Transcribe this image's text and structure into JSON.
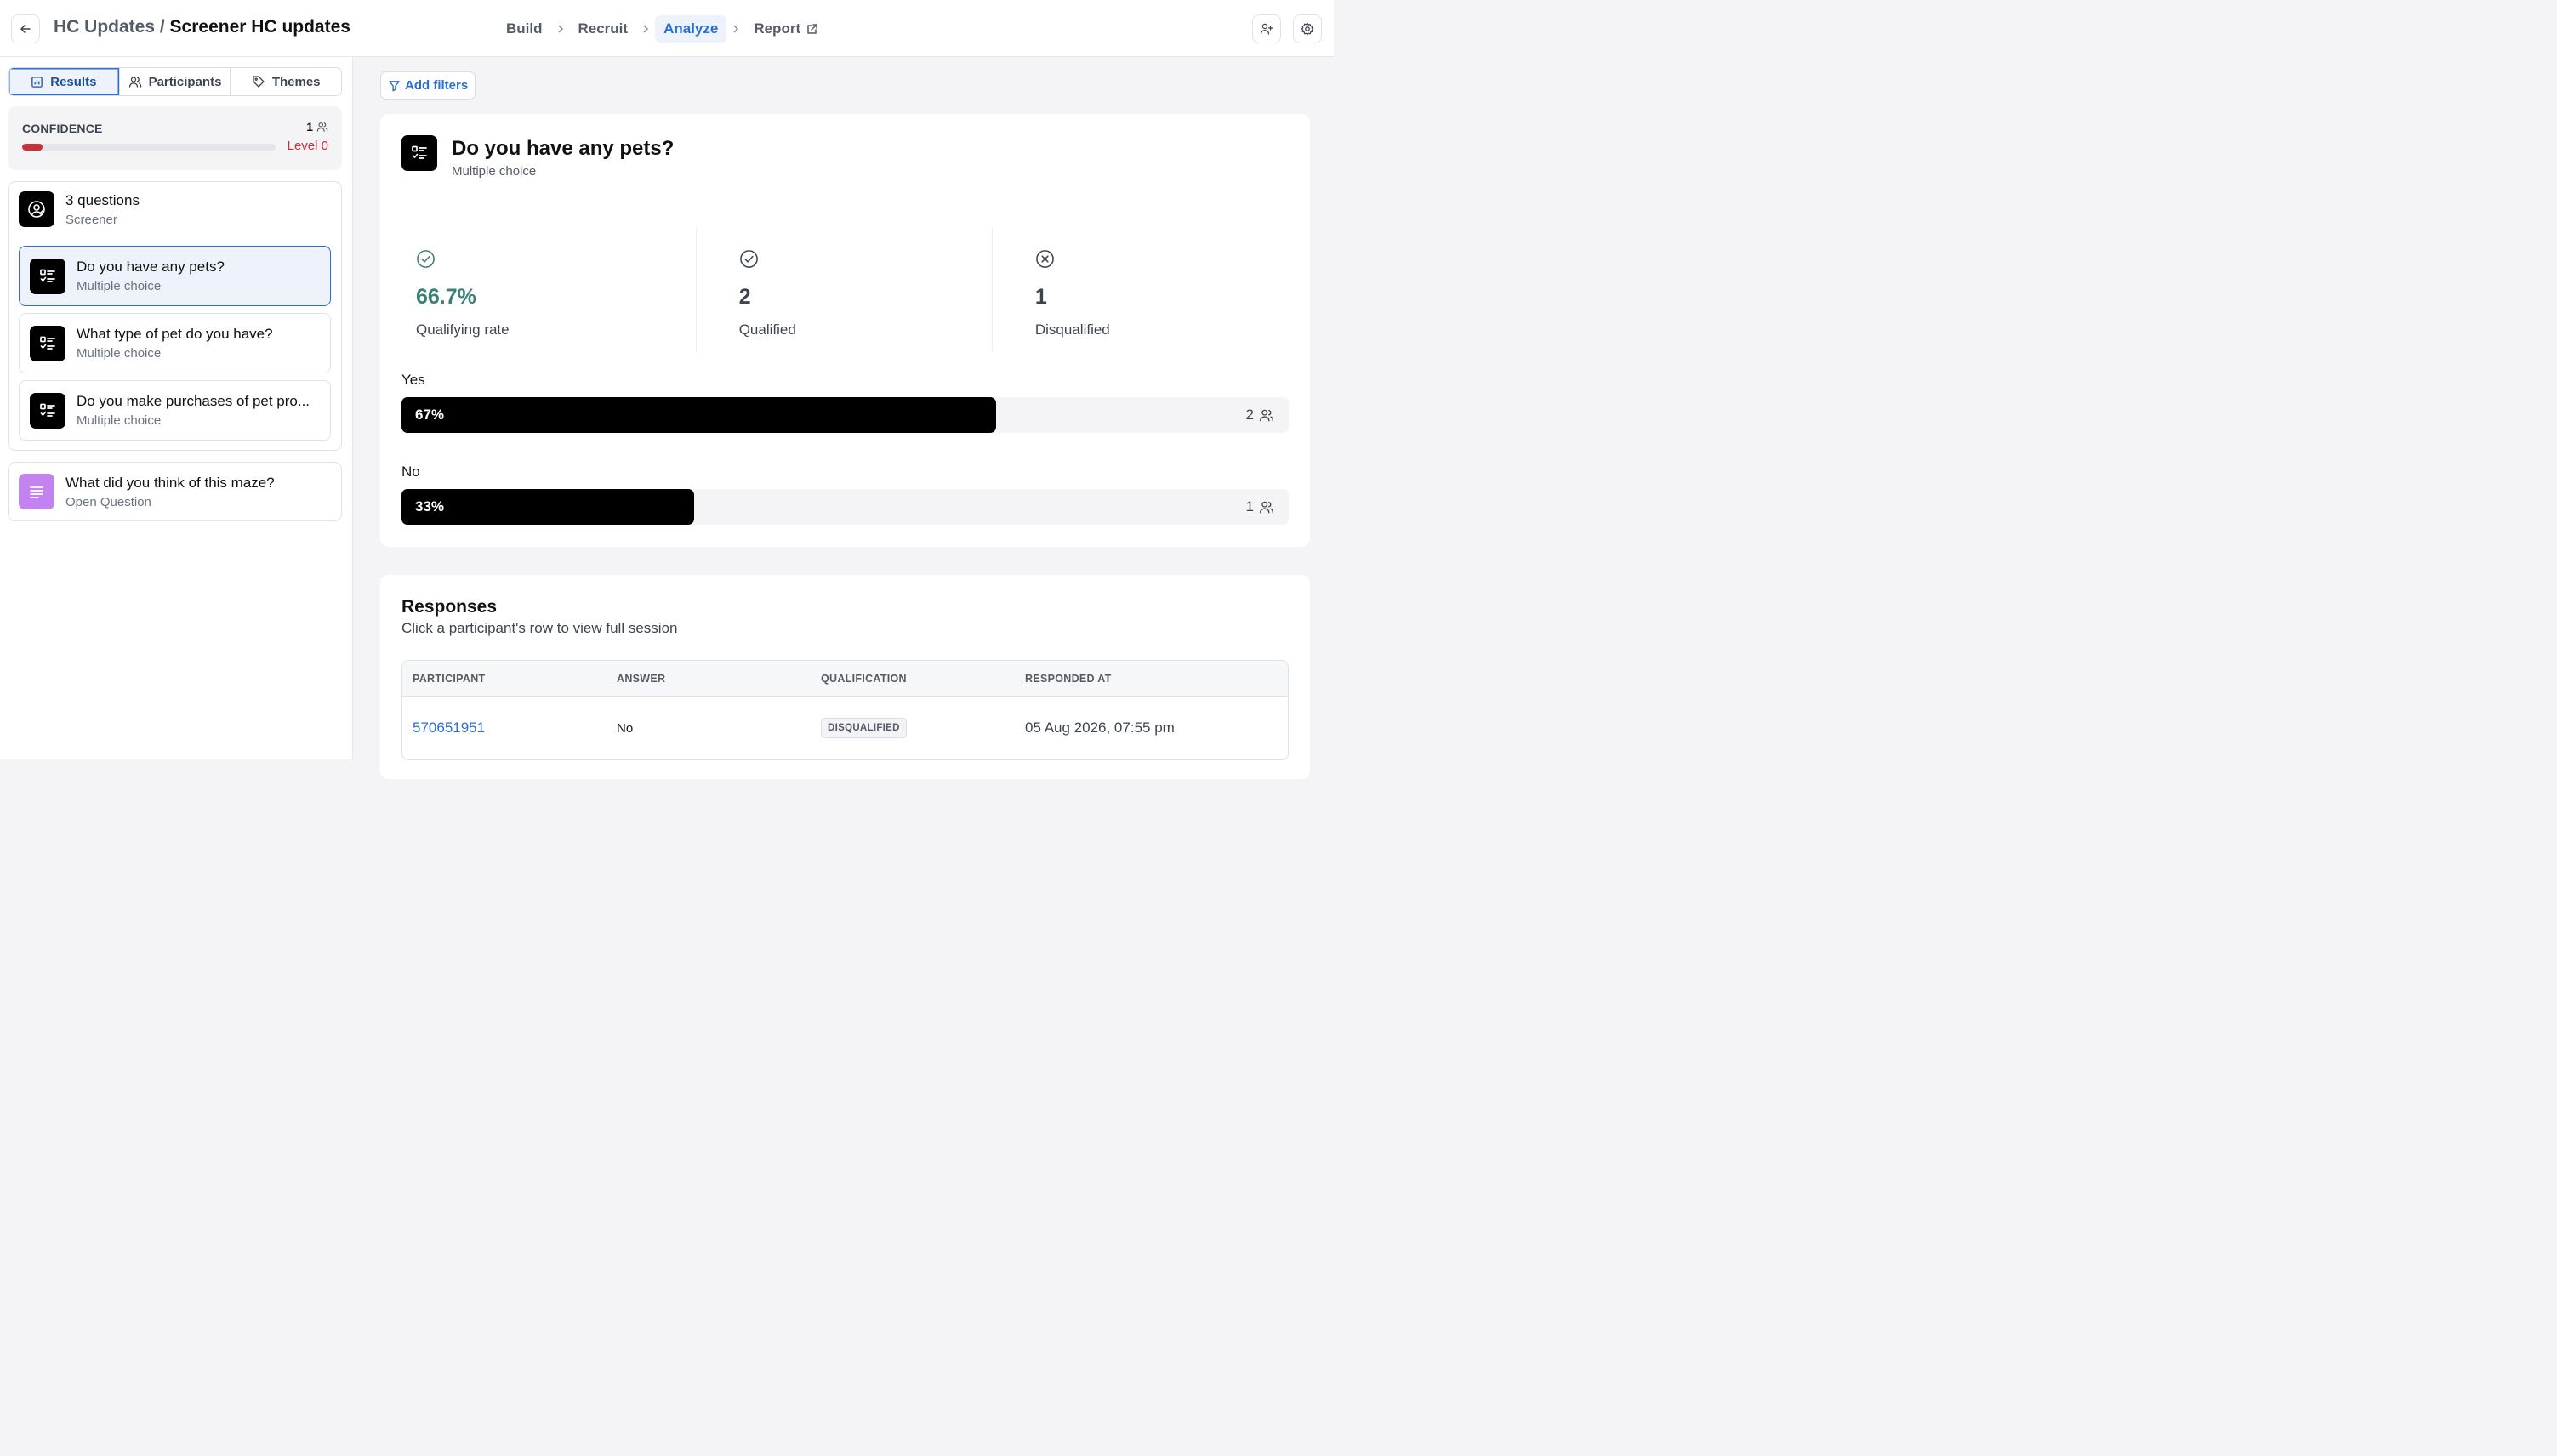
{
  "header": {
    "project": "HC Updates",
    "separator": " / ",
    "study": "Screener HC updates",
    "steps": [
      {
        "label": "Build"
      },
      {
        "label": "Recruit"
      },
      {
        "label": "Analyze"
      },
      {
        "label": "Report"
      }
    ],
    "active_step": "Analyze"
  },
  "sidebar": {
    "tabs": [
      {
        "label": "Results"
      },
      {
        "label": "Participants"
      },
      {
        "label": "Themes"
      }
    ],
    "confidence": {
      "label": "CONFIDENCE",
      "count": "1",
      "level": "Level 0",
      "progress": 0.08
    },
    "screener": {
      "title": "3 questions",
      "subtitle": "Screener",
      "questions": [
        {
          "title": "Do you have any pets?",
          "type": "Multiple choice"
        },
        {
          "title": "What type of pet do you have?",
          "type": "Multiple choice"
        },
        {
          "title": "Do you make purchases of pet pro...",
          "type": "Multiple choice"
        }
      ]
    },
    "maze_question": {
      "title": "What did you think of this maze?",
      "type": "Open Question"
    }
  },
  "main": {
    "add_filters": "Add filters",
    "question": {
      "title": "Do you have any pets?",
      "type": "Multiple choice"
    },
    "stats": [
      {
        "value": "66.7%",
        "label": "Qualifying rate"
      },
      {
        "value": "2",
        "label": "Qualified"
      },
      {
        "value": "1",
        "label": "Disqualified"
      }
    ],
    "options": [
      {
        "label": "Yes",
        "percent_label": "67%",
        "fraction": 0.67,
        "count": "2"
      },
      {
        "label": "No",
        "percent_label": "33%",
        "fraction": 0.33,
        "count": "1"
      }
    ],
    "responses": {
      "title": "Responses",
      "subtitle": "Click a participant's row to view full session",
      "columns": [
        "PARTICIPANT",
        "ANSWER",
        "QUALIFICATION",
        "RESPONDED AT"
      ],
      "rows": [
        {
          "participant": "570651951",
          "answer": "No",
          "qualification": "DISQUALIFIED",
          "responded_at": "05 Aug 2026, 07:55 pm"
        }
      ]
    }
  },
  "colors": {
    "accent": "#2a6ed6",
    "danger": "#c8303a",
    "success": "#3a8077",
    "purple_icon": "#c283f0"
  }
}
